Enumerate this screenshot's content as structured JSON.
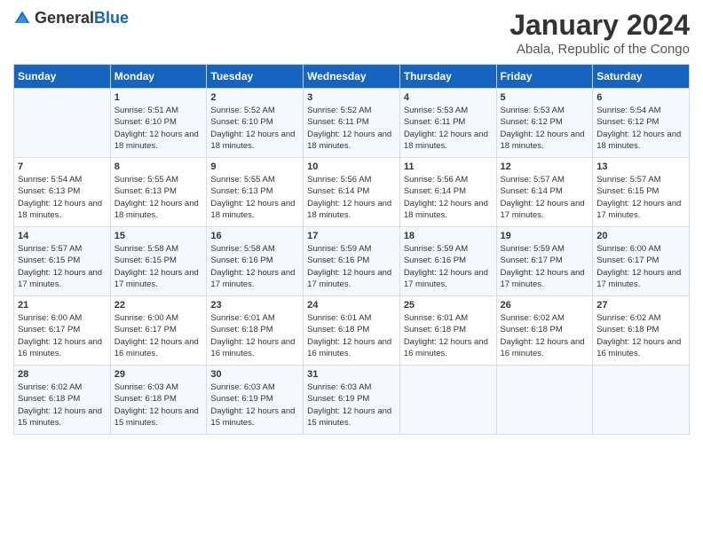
{
  "header": {
    "logo_general": "General",
    "logo_blue": "Blue",
    "title": "January 2024",
    "subtitle": "Abala, Republic of the Congo"
  },
  "columns": [
    "Sunday",
    "Monday",
    "Tuesday",
    "Wednesday",
    "Thursday",
    "Friday",
    "Saturday"
  ],
  "weeks": [
    [
      {
        "day": "",
        "sunrise": "",
        "sunset": "",
        "daylight": ""
      },
      {
        "day": "1",
        "sunrise": "Sunrise: 5:51 AM",
        "sunset": "Sunset: 6:10 PM",
        "daylight": "Daylight: 12 hours and 18 minutes."
      },
      {
        "day": "2",
        "sunrise": "Sunrise: 5:52 AM",
        "sunset": "Sunset: 6:10 PM",
        "daylight": "Daylight: 12 hours and 18 minutes."
      },
      {
        "day": "3",
        "sunrise": "Sunrise: 5:52 AM",
        "sunset": "Sunset: 6:11 PM",
        "daylight": "Daylight: 12 hours and 18 minutes."
      },
      {
        "day": "4",
        "sunrise": "Sunrise: 5:53 AM",
        "sunset": "Sunset: 6:11 PM",
        "daylight": "Daylight: 12 hours and 18 minutes."
      },
      {
        "day": "5",
        "sunrise": "Sunrise: 5:53 AM",
        "sunset": "Sunset: 6:12 PM",
        "daylight": "Daylight: 12 hours and 18 minutes."
      },
      {
        "day": "6",
        "sunrise": "Sunrise: 5:54 AM",
        "sunset": "Sunset: 6:12 PM",
        "daylight": "Daylight: 12 hours and 18 minutes."
      }
    ],
    [
      {
        "day": "7",
        "sunrise": "Sunrise: 5:54 AM",
        "sunset": "Sunset: 6:13 PM",
        "daylight": "Daylight: 12 hours and 18 minutes."
      },
      {
        "day": "8",
        "sunrise": "Sunrise: 5:55 AM",
        "sunset": "Sunset: 6:13 PM",
        "daylight": "Daylight: 12 hours and 18 minutes."
      },
      {
        "day": "9",
        "sunrise": "Sunrise: 5:55 AM",
        "sunset": "Sunset: 6:13 PM",
        "daylight": "Daylight: 12 hours and 18 minutes."
      },
      {
        "day": "10",
        "sunrise": "Sunrise: 5:56 AM",
        "sunset": "Sunset: 6:14 PM",
        "daylight": "Daylight: 12 hours and 18 minutes."
      },
      {
        "day": "11",
        "sunrise": "Sunrise: 5:56 AM",
        "sunset": "Sunset: 6:14 PM",
        "daylight": "Daylight: 12 hours and 18 minutes."
      },
      {
        "day": "12",
        "sunrise": "Sunrise: 5:57 AM",
        "sunset": "Sunset: 6:14 PM",
        "daylight": "Daylight: 12 hours and 17 minutes."
      },
      {
        "day": "13",
        "sunrise": "Sunrise: 5:57 AM",
        "sunset": "Sunset: 6:15 PM",
        "daylight": "Daylight: 12 hours and 17 minutes."
      }
    ],
    [
      {
        "day": "14",
        "sunrise": "Sunrise: 5:57 AM",
        "sunset": "Sunset: 6:15 PM",
        "daylight": "Daylight: 12 hours and 17 minutes."
      },
      {
        "day": "15",
        "sunrise": "Sunrise: 5:58 AM",
        "sunset": "Sunset: 6:15 PM",
        "daylight": "Daylight: 12 hours and 17 minutes."
      },
      {
        "day": "16",
        "sunrise": "Sunrise: 5:58 AM",
        "sunset": "Sunset: 6:16 PM",
        "daylight": "Daylight: 12 hours and 17 minutes."
      },
      {
        "day": "17",
        "sunrise": "Sunrise: 5:59 AM",
        "sunset": "Sunset: 6:16 PM",
        "daylight": "Daylight: 12 hours and 17 minutes."
      },
      {
        "day": "18",
        "sunrise": "Sunrise: 5:59 AM",
        "sunset": "Sunset: 6:16 PM",
        "daylight": "Daylight: 12 hours and 17 minutes."
      },
      {
        "day": "19",
        "sunrise": "Sunrise: 5:59 AM",
        "sunset": "Sunset: 6:17 PM",
        "daylight": "Daylight: 12 hours and 17 minutes."
      },
      {
        "day": "20",
        "sunrise": "Sunrise: 6:00 AM",
        "sunset": "Sunset: 6:17 PM",
        "daylight": "Daylight: 12 hours and 17 minutes."
      }
    ],
    [
      {
        "day": "21",
        "sunrise": "Sunrise: 6:00 AM",
        "sunset": "Sunset: 6:17 PM",
        "daylight": "Daylight: 12 hours and 16 minutes."
      },
      {
        "day": "22",
        "sunrise": "Sunrise: 6:00 AM",
        "sunset": "Sunset: 6:17 PM",
        "daylight": "Daylight: 12 hours and 16 minutes."
      },
      {
        "day": "23",
        "sunrise": "Sunrise: 6:01 AM",
        "sunset": "Sunset: 6:18 PM",
        "daylight": "Daylight: 12 hours and 16 minutes."
      },
      {
        "day": "24",
        "sunrise": "Sunrise: 6:01 AM",
        "sunset": "Sunset: 6:18 PM",
        "daylight": "Daylight: 12 hours and 16 minutes."
      },
      {
        "day": "25",
        "sunrise": "Sunrise: 6:01 AM",
        "sunset": "Sunset: 6:18 PM",
        "daylight": "Daylight: 12 hours and 16 minutes."
      },
      {
        "day": "26",
        "sunrise": "Sunrise: 6:02 AM",
        "sunset": "Sunset: 6:18 PM",
        "daylight": "Daylight: 12 hours and 16 minutes."
      },
      {
        "day": "27",
        "sunrise": "Sunrise: 6:02 AM",
        "sunset": "Sunset: 6:18 PM",
        "daylight": "Daylight: 12 hours and 16 minutes."
      }
    ],
    [
      {
        "day": "28",
        "sunrise": "Sunrise: 6:02 AM",
        "sunset": "Sunset: 6:18 PM",
        "daylight": "Daylight: 12 hours and 15 minutes."
      },
      {
        "day": "29",
        "sunrise": "Sunrise: 6:03 AM",
        "sunset": "Sunset: 6:18 PM",
        "daylight": "Daylight: 12 hours and 15 minutes."
      },
      {
        "day": "30",
        "sunrise": "Sunrise: 6:03 AM",
        "sunset": "Sunset: 6:19 PM",
        "daylight": "Daylight: 12 hours and 15 minutes."
      },
      {
        "day": "31",
        "sunrise": "Sunrise: 6:03 AM",
        "sunset": "Sunset: 6:19 PM",
        "daylight": "Daylight: 12 hours and 15 minutes."
      },
      {
        "day": "",
        "sunrise": "",
        "sunset": "",
        "daylight": ""
      },
      {
        "day": "",
        "sunrise": "",
        "sunset": "",
        "daylight": ""
      },
      {
        "day": "",
        "sunrise": "",
        "sunset": "",
        "daylight": ""
      }
    ]
  ]
}
